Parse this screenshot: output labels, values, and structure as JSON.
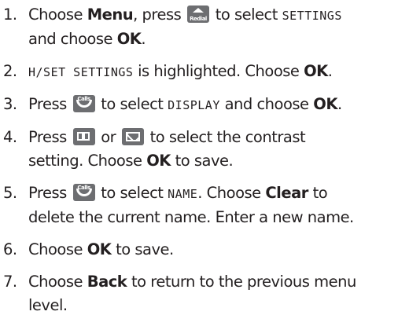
{
  "steps": [
    {
      "num": "1.",
      "a": "Choose ",
      "menu": "Menu",
      "b": ", press ",
      "redial_text": "Redial",
      "c": " to select ",
      "settings": "SETTINGS",
      "d": "and choose ",
      "ok": "OK",
      "e": "."
    },
    {
      "num": "2.",
      "hset": "H/SET SETTINGS",
      "a": " is highlighted. Choose ",
      "ok": "OK",
      "b": "."
    },
    {
      "num": "3.",
      "a": "Press ",
      "calls_text": "Calls",
      "b": " to select ",
      "display": "DISPLAY",
      "c": " and choose ",
      "ok": "OK",
      "d": "."
    },
    {
      "num": "4.",
      "a": "Press ",
      "b": " or ",
      "c": " to select the contrast",
      "d": "setting. Choose ",
      "ok": "OK",
      "e": " to save."
    },
    {
      "num": "5.",
      "a": "Press ",
      "calls_text": "Calls",
      "b": " to select ",
      "name": "NAME",
      "c": ". Choose ",
      "clear": "Clear",
      "d": " to",
      "e": "delete the current name. Enter a new name."
    },
    {
      "num": "6.",
      "a": "Choose ",
      "ok": "OK",
      "b": " to save."
    },
    {
      "num": "7.",
      "a": "Choose ",
      "back": "Back",
      "b": " to return to the previous menu",
      "c": "level."
    }
  ],
  "icons": {
    "key_color": "#6d6e71",
    "redial": "redial-key-icon",
    "calls": "calls-key-icon",
    "phonebook": "phonebook-key-icon",
    "messages": "messages-key-icon"
  }
}
